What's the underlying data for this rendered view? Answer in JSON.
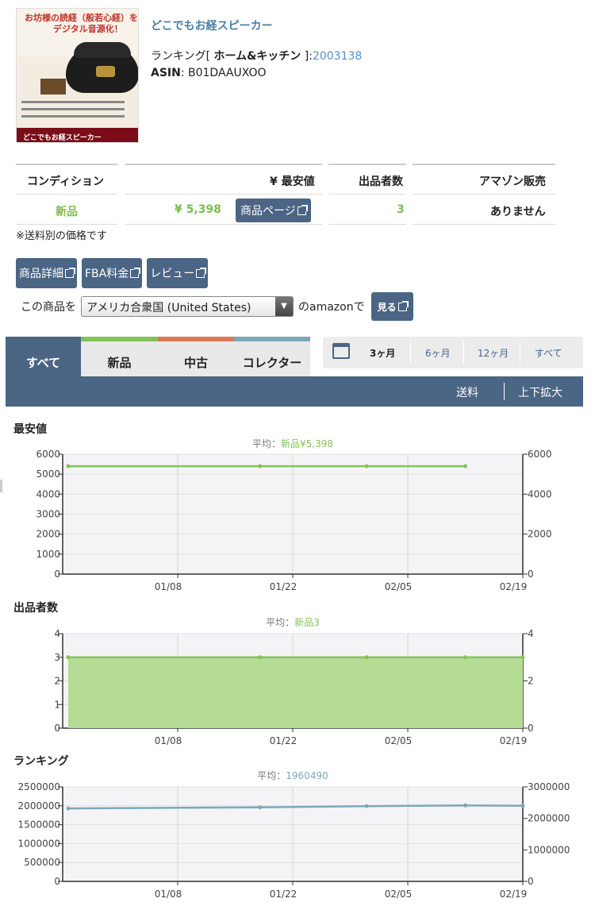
{
  "product": {
    "title": "どこでもお経スピーカー",
    "ranking_prefix": "ランキング[ ",
    "ranking_category": "ホーム&キッチン",
    "ranking_suffix": " ]:",
    "ranking_value": "2003138",
    "asin_label": "ASIN",
    "asin_value": ": B01DAAUXOO",
    "image": {
      "caption1": "お坊様の読経（般若心経）を",
      "caption2": "デジタル音源化！",
      "footer": "どこでもお経スピーカー"
    }
  },
  "price_table": {
    "headers": [
      "コンディション",
      "¥ 最安値",
      "出品者数",
      "アマゾン販売"
    ],
    "row": {
      "condition": "新品",
      "price": "¥ 5,398",
      "product_page_button": "商品ページ",
      "sellers": "3",
      "amazon": "ありません"
    }
  },
  "shipping_note": "※送料別の価格です",
  "buttons": {
    "details": "商品詳細",
    "fba": "FBA料金",
    "review": "レビュー"
  },
  "country_select": {
    "prefix": "この商品を",
    "selected": "アメリカ合衆国 (United States)",
    "suffix": "のamazonで",
    "see_button": "見る"
  },
  "tabs": {
    "all": "すべて",
    "new": "新品",
    "used": "中古",
    "collector": "コレクター"
  },
  "ranges": [
    "3ヶ月",
    "6ヶ月",
    "12ヶ月",
    "すべて"
  ],
  "toolbar": {
    "shipping": "送料",
    "zoom": "上下拡大"
  },
  "colors": {
    "accent": "#4b6584",
    "new": "#86c25a",
    "used": "#d97c58",
    "collector": "#7fa8b8",
    "rank_line": "#7fa8b8"
  },
  "chart_data": [
    {
      "type": "line",
      "title": "最安値",
      "avg_label": "平均：",
      "avg_value": "新品¥5,398",
      "x_ticks": [
        "01/08",
        "01/22",
        "02/05",
        "02/19"
      ],
      "x_domain": [
        "12/25",
        "02/19"
      ],
      "left_ticks": [
        "0",
        "1000",
        "2000",
        "3000",
        "4000",
        "5000",
        "6000"
      ],
      "right_ticks": [
        "0",
        "2000",
        "4000",
        "6000"
      ],
      "ylim": [
        0,
        6000
      ],
      "right_ylim": [
        0,
        6000
      ],
      "grid": true,
      "series": [
        {
          "x": [
            "12/25",
            "01/18",
            "01/31",
            "02/12"
          ],
          "y": [
            5398,
            5398,
            5398,
            5398
          ]
        }
      ]
    },
    {
      "type": "area",
      "title": "出品者数",
      "avg_label": "平均：",
      "avg_value": "新品3",
      "x_ticks": [
        "01/08",
        "01/22",
        "02/05",
        "02/19"
      ],
      "x_domain": [
        "12/25",
        "02/19"
      ],
      "left_ticks": [
        "0",
        "1",
        "2",
        "3",
        "4"
      ],
      "right_ticks": [
        "0",
        "2",
        "4"
      ],
      "ylim": [
        0,
        4
      ],
      "right_ylim": [
        0,
        4
      ],
      "grid": true,
      "series": [
        {
          "x": [
            "12/25",
            "01/18",
            "01/31",
            "02/12",
            "02/19"
          ],
          "y": [
            3,
            3,
            3,
            3,
            3
          ]
        }
      ]
    },
    {
      "type": "line",
      "title": "ランキング",
      "avg_label": "平均：",
      "avg_value": "1960490",
      "x_ticks": [
        "01/08",
        "01/22",
        "02/05",
        "02/19"
      ],
      "x_domain": [
        "12/25",
        "02/19"
      ],
      "left_ticks": [
        "0",
        "500000",
        "1000000",
        "1500000",
        "2000000",
        "2500000"
      ],
      "right_ticks": [
        "0",
        "1000000",
        "2000000",
        "3000000"
      ],
      "ylim": [
        0,
        2500000
      ],
      "right_ylim": [
        0,
        3000000
      ],
      "grid": true,
      "series": [
        {
          "x": [
            "12/25",
            "01/18",
            "01/31",
            "02/12",
            "02/19"
          ],
          "y": [
            1930000,
            1960000,
            1990000,
            2010000,
            2000000
          ]
        }
      ]
    }
  ]
}
